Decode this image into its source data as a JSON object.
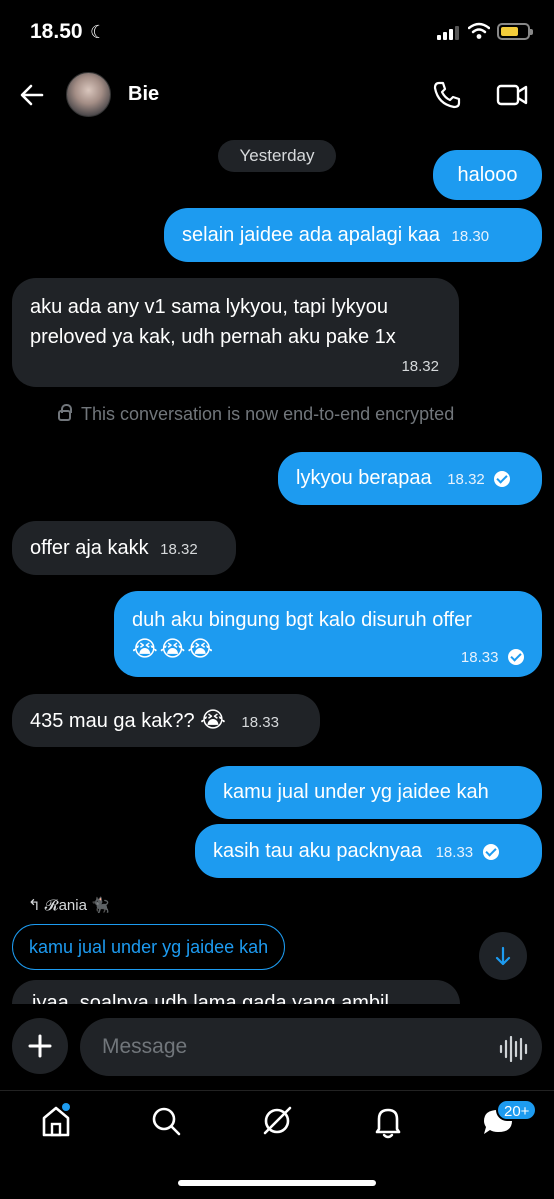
{
  "status_bar": {
    "time": "18.50"
  },
  "header": {
    "contact_name": "Bie"
  },
  "messages": {
    "date_chip": "Yesterday",
    "m1": {
      "text": "halooo"
    },
    "m2": {
      "text": "selain jaidee ada apalagi kaa",
      "time": "18.30"
    },
    "m3": {
      "line1": "aku ada any v1 sama lykyou, tapi lykyou",
      "line2": "preloved ya kak, udh pernah aku pake 1x",
      "time": "18.32"
    },
    "encryption_notice": "This conversation is now end-to-end encrypted",
    "m4": {
      "text": "lykyou berapaa",
      "time": "18.32"
    },
    "m5": {
      "text": "offer aja kakk",
      "time": "18.32"
    },
    "m6": {
      "text": "duh aku bingung bgt kalo disuruh offer",
      "emoji": "😭😭😭",
      "time": "18.33"
    },
    "m7": {
      "text": "435 mau ga kak??",
      "emoji": "😭",
      "time": "18.33"
    },
    "m8": {
      "text": "kamu jual under yg jaidee kah"
    },
    "m9": {
      "text": "kasih tau aku packnyaa",
      "time": "18.33"
    },
    "reply": {
      "author": "𝓡ania 🐈‍⬛",
      "quote": "kamu jual under yg jaidee kah"
    },
    "partial": {
      "text": "iyaa, soalnya udh lama gada yang ambil"
    }
  },
  "composer": {
    "placeholder": "Message"
  },
  "tabbar": {
    "messages_badge": "20+"
  },
  "colors": {
    "accent": "#1d9bf0",
    "bubble_in": "#202327",
    "background": "#000000"
  }
}
